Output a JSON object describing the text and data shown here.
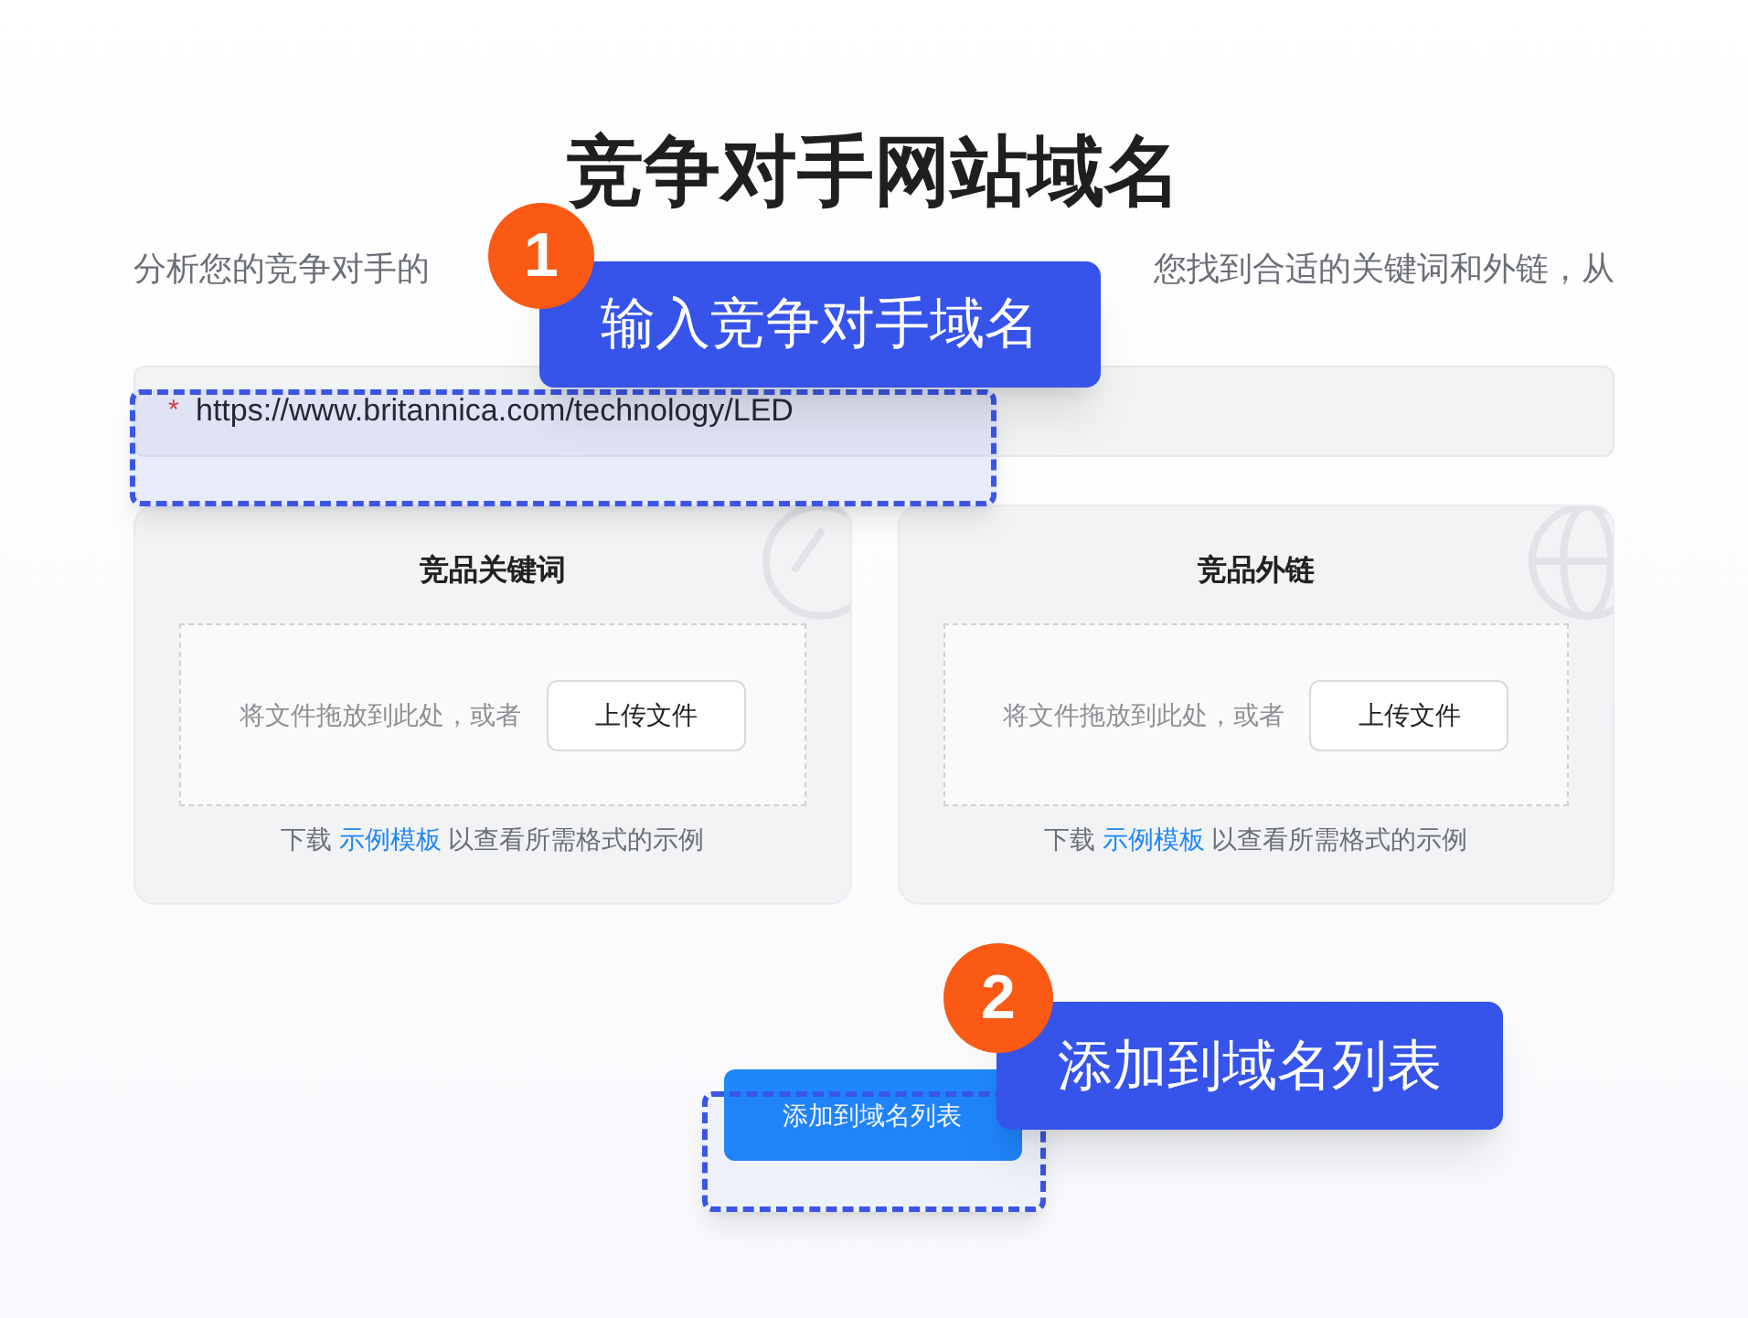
{
  "title": "竞争对手网站域名",
  "subtitle_parts": [
    "分析您的竞争对手的",
    "您找到合适的关键词和外链，从"
  ],
  "domain_field": {
    "required_mark": "*",
    "value": "https://www.britannica.com/technology/LED"
  },
  "upload_cards": [
    {
      "kind": "keywords",
      "title": "竞品关键词",
      "drop_hint": "将文件拖放到此处，或者",
      "upload_button": "上传文件",
      "help_prefix": "下载",
      "help_link": "示例模板",
      "help_suffix": "以查看所需格式的示例"
    },
    {
      "kind": "backlinks",
      "title": "竞品外链",
      "drop_hint": "将文件拖放到此处，或者",
      "upload_button": "上传文件",
      "help_prefix": "下载",
      "help_link": "示例模板",
      "help_suffix": "以查看所需格式的示例"
    }
  ],
  "add_button": "添加到域名列表",
  "callouts": [
    {
      "number": "1",
      "label": "输入竞争对手域名"
    },
    {
      "number": "2",
      "label": "添加到域名列表"
    }
  ]
}
